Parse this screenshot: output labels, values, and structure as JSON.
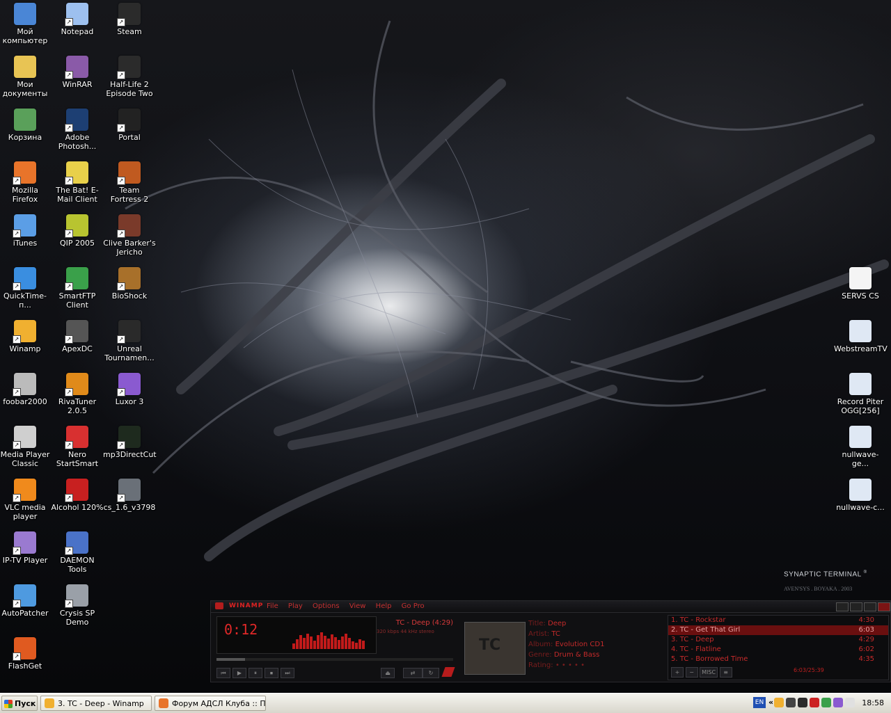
{
  "desktop": {
    "icons": [
      {
        "label": "Мой компьютер",
        "icon": "my-computer-icon",
        "color": "#4a86d6",
        "shortcut": false
      },
      {
        "label": "Мои документы",
        "icon": "my-documents-icon",
        "color": "#e8c454",
        "shortcut": false
      },
      {
        "label": "Корзина",
        "icon": "recycle-bin-icon",
        "color": "#5aa05a",
        "shortcut": false
      },
      {
        "label": "Mozilla Firefox",
        "icon": "firefox-icon",
        "color": "#e8742a",
        "shortcut": true
      },
      {
        "label": "iTunes",
        "icon": "itunes-icon",
        "color": "#5b9ee6",
        "shortcut": true
      },
      {
        "label": "QuickTime-п...",
        "icon": "quicktime-icon",
        "color": "#3a8ee0",
        "shortcut": true
      },
      {
        "label": "Winamp",
        "icon": "winamp-icon",
        "color": "#f0b030",
        "shortcut": true
      },
      {
        "label": "foobar2000",
        "icon": "foobar-icon",
        "color": "#bbbbbb",
        "shortcut": true
      },
      {
        "label": "Media Player Classic",
        "icon": "media-player-classic-icon",
        "color": "#cfcfcf",
        "shortcut": true
      },
      {
        "label": "VLC media player",
        "icon": "vlc-icon",
        "color": "#f08a1c",
        "shortcut": true
      },
      {
        "label": "IP-TV Player",
        "icon": "iptv-icon",
        "color": "#9a7ad0",
        "shortcut": true
      },
      {
        "label": "AutoPatcher",
        "icon": "autopatcher-icon",
        "color": "#4e9ae0",
        "shortcut": true
      },
      {
        "label": "FlashGet",
        "icon": "flashget-icon",
        "color": "#e05a20",
        "shortcut": true
      },
      {
        "label": "Notepad",
        "icon": "notepad-icon",
        "color": "#9dc0ef",
        "shortcut": true
      },
      {
        "label": "WinRAR",
        "icon": "winrar-icon",
        "color": "#8a5aa8",
        "shortcut": true
      },
      {
        "label": "Adobe Photosh...",
        "icon": "photoshop-icon",
        "color": "#1d3f73",
        "shortcut": true
      },
      {
        "label": "The Bat! E-Mail Client",
        "icon": "the-bat-icon",
        "color": "#e8d04a",
        "shortcut": true
      },
      {
        "label": "QIP 2005",
        "icon": "qip-icon",
        "color": "#b8c430",
        "shortcut": true
      },
      {
        "label": "SmartFTP Client",
        "icon": "smartftp-icon",
        "color": "#3aa04a",
        "shortcut": true
      },
      {
        "label": "ApexDC",
        "icon": "apexdc-icon",
        "color": "#555555",
        "shortcut": true
      },
      {
        "label": "RivaTuner 2.0.5",
        "icon": "rivatuner-icon",
        "color": "#e08a1a",
        "shortcut": true
      },
      {
        "label": "Nero StartSmart",
        "icon": "nero-icon",
        "color": "#d83030",
        "shortcut": true
      },
      {
        "label": "Alcohol 120%",
        "icon": "alcohol-icon",
        "color": "#c82020",
        "shortcut": true
      },
      {
        "label": "DAEMON Tools",
        "icon": "daemon-tools-icon",
        "color": "#4a72c8",
        "shortcut": true
      },
      {
        "label": "Crysis SP Demo",
        "icon": "crysis-icon",
        "color": "#9aa0a8",
        "shortcut": true
      },
      {
        "label": "Steam",
        "icon": "steam-icon",
        "color": "#2b2b2b",
        "shortcut": true
      },
      {
        "label": "Half-Life 2 Episode Two",
        "icon": "half-life-icon",
        "color": "#2b2b2b",
        "shortcut": true
      },
      {
        "label": "Portal",
        "icon": "portal-icon",
        "color": "#222222",
        "shortcut": true
      },
      {
        "label": "Team Fortress 2",
        "icon": "team-fortress-icon",
        "color": "#c05a20",
        "shortcut": true
      },
      {
        "label": "Clive Barker's Jericho",
        "icon": "jericho-icon",
        "color": "#7a3a2a",
        "shortcut": true
      },
      {
        "label": "BioShock",
        "icon": "bioshock-icon",
        "color": "#a8702a",
        "shortcut": true
      },
      {
        "label": "Unreal Tournamen...",
        "icon": "unreal-icon",
        "color": "#2a2a2a",
        "shortcut": true
      },
      {
        "label": "Luxor 3",
        "icon": "luxor-icon",
        "color": "#8a5ad0",
        "shortcut": true
      },
      {
        "label": "mp3DirectCut",
        "icon": "mp3directcut-icon",
        "color": "#1e2a1e",
        "shortcut": true
      },
      {
        "label": "cs_1.6_v3798",
        "icon": "counter-strike-icon",
        "color": "#6a7078",
        "shortcut": true
      },
      {
        "label": "SERVS CS",
        "icon": "text-file-icon",
        "color": "#f4f4f4",
        "shortcut": false
      },
      {
        "label": "WebstreamTV",
        "icon": "winamp-playlist-icon",
        "color": "#dfe8f4",
        "shortcut": false
      },
      {
        "label": "Record Piter OGG[256]",
        "icon": "winamp-playlist-icon",
        "color": "#dfe8f4",
        "shortcut": false
      },
      {
        "label": "nullwave-ge...",
        "icon": "winamp-playlist-icon",
        "color": "#dfe8f4",
        "shortcut": false
      },
      {
        "label": "nullwave-c...",
        "icon": "winamp-playlist-icon",
        "color": "#dfe8f4",
        "shortcut": false
      }
    ]
  },
  "wallpaper": {
    "title": "SYNAPTIC TERMINAL",
    "mark": "®",
    "credit": "AVEN'SYS . BOYAKA . 2003"
  },
  "winamp": {
    "brand": "WINAMP",
    "menu": [
      "File",
      "Play",
      "Options",
      "View",
      "Help",
      "Go Pro"
    ],
    "time": "0:12",
    "track": "TC - Deep (4:29)",
    "bitrate_info": "320 kbps   44 kHz   stereo",
    "seek_position": 0.12,
    "album_art_text": "TC",
    "meta": {
      "title_label": "Title:",
      "title": "Deep",
      "artist_label": "Artist:",
      "artist": "TC",
      "album_label": "Album:",
      "album": "Evolution CD1",
      "genre_label": "Genre:",
      "genre": "Drum & Bass",
      "rating_label": "Rating:",
      "rating": "• • • • •"
    },
    "playlist": [
      {
        "title": "1. TC - Rockstar",
        "duration": "4:30",
        "selected": false
      },
      {
        "title": "2. TC - Get That Girl",
        "duration": "6:03",
        "selected": true
      },
      {
        "title": "3. TC - Deep",
        "duration": "4:29",
        "selected": false
      },
      {
        "title": "4. TC - Flatline",
        "duration": "6:02",
        "selected": false
      },
      {
        "title": "5. TC - Borrowed Time",
        "duration": "4:35",
        "selected": false
      }
    ],
    "playlist_buttons": [
      "+",
      "−",
      "MISC",
      "≡"
    ],
    "playlist_total": "6:03/25:39",
    "transport": [
      "⏮",
      "▶",
      "⏸",
      "⏹",
      "⏭"
    ],
    "spectrum": [
      8,
      14,
      20,
      16,
      22,
      18,
      12,
      20,
      24,
      19,
      15,
      21,
      17,
      13,
      18,
      22,
      16,
      11,
      9,
      14,
      12
    ]
  },
  "taskbar": {
    "start_label": "Пуск",
    "tasks": [
      {
        "label": "3. TC - Deep - Winamp",
        "color": "#f0b030"
      },
      {
        "label": "Форум АДСЛ Клуба :: П...",
        "color": "#e8742a"
      }
    ],
    "language": "EN",
    "tray_colors": [
      "#f0b030",
      "#444444",
      "#2b2b2b",
      "#cc2222",
      "#3aa04a",
      "#8a5ad0",
      "#e0e0e0"
    ],
    "clock": "18:58"
  }
}
